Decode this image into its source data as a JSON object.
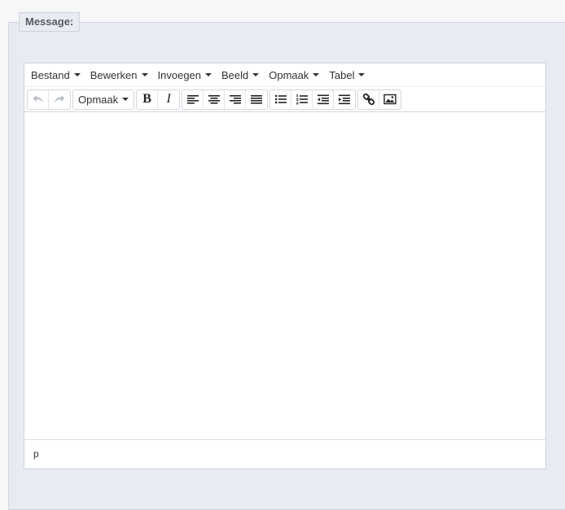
{
  "form": {
    "legend": "Message:"
  },
  "editor": {
    "menubar": [
      {
        "label": "Bestand"
      },
      {
        "label": "Bewerken"
      },
      {
        "label": "Invoegen"
      },
      {
        "label": "Beeld"
      },
      {
        "label": "Opmaak"
      },
      {
        "label": "Tabel"
      }
    ],
    "toolbar": {
      "format_select": "Opmaak",
      "bold_glyph": "B",
      "italic_glyph": "I",
      "icons": [
        "undo-icon",
        "redo-icon",
        "align-left-icon",
        "align-center-icon",
        "align-right-icon",
        "align-justify-icon",
        "bullet-list-icon",
        "numbered-list-icon",
        "outdent-icon",
        "indent-icon",
        "link-icon",
        "image-icon"
      ]
    },
    "content": "",
    "statusbar": {
      "path": "p"
    }
  }
}
